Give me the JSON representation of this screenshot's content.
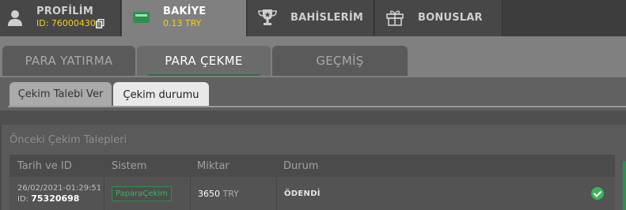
{
  "top_tabs": {
    "profile": {
      "title": "PROFİLİM",
      "id_text": "ID: 76000430",
      "icon": "user-icon"
    },
    "balance": {
      "title": "BAKİYE",
      "amount": "0.13 TRY",
      "icon": "wallet-icon"
    },
    "bets": {
      "title": "BAHİSLERİM",
      "icon": "trophy-icon"
    },
    "bonus": {
      "title": "BONUSLAR",
      "icon": "gift-icon"
    }
  },
  "secondary_tabs": [
    "PARA YATIRMA",
    "PARA ÇEKME",
    "GEÇMİŞ"
  ],
  "withdraw_tabs": [
    "Çekim Talebi Ver",
    "Çekim durumu"
  ],
  "previous": {
    "title": "Önceki Çekim Talepleri",
    "headers": [
      "Tarih ve ID",
      "Sistem",
      "Miktar",
      "Durum"
    ],
    "rows": [
      {
        "date": "26/02/2021-01:29:51",
        "id_label": "ID:",
        "id": "75320698",
        "system": "PaparaÇekim",
        "amount": "3650",
        "currency": "TRY",
        "status": "ÖDENDİ"
      }
    ]
  },
  "colors": {
    "accent_green": "#3cb35f",
    "id_yellow": "#f2d21b"
  }
}
